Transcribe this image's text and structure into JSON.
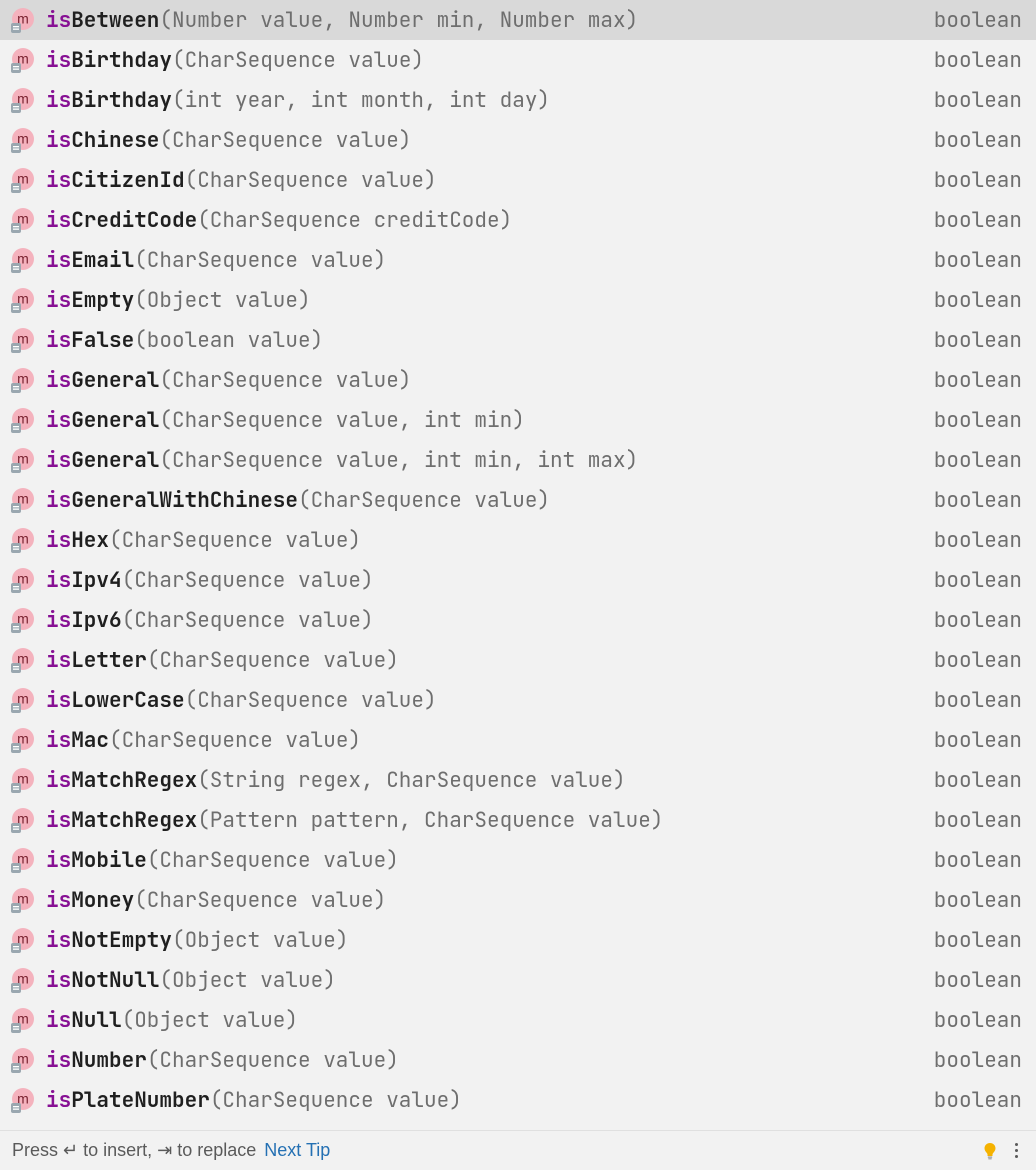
{
  "suggestions": [
    {
      "prefix": "is",
      "bold": "Between",
      "params": "(Number value, Number min, Number max)",
      "ret": "boolean",
      "selected": true
    },
    {
      "prefix": "is",
      "bold": "Birthday",
      "params": "(CharSequence value)",
      "ret": "boolean"
    },
    {
      "prefix": "is",
      "bold": "Birthday",
      "params": "(int year, int month, int day)",
      "ret": "boolean"
    },
    {
      "prefix": "is",
      "bold": "Chinese",
      "params": "(CharSequence value)",
      "ret": "boolean"
    },
    {
      "prefix": "is",
      "bold": "CitizenId",
      "params": "(CharSequence value)",
      "ret": "boolean"
    },
    {
      "prefix": "is",
      "bold": "CreditCode",
      "params": "(CharSequence creditCode)",
      "ret": "boolean"
    },
    {
      "prefix": "is",
      "bold": "Email",
      "params": "(CharSequence value)",
      "ret": "boolean"
    },
    {
      "prefix": "is",
      "bold": "Empty",
      "params": "(Object value)",
      "ret": "boolean"
    },
    {
      "prefix": "is",
      "bold": "False",
      "params": "(boolean value)",
      "ret": "boolean"
    },
    {
      "prefix": "is",
      "bold": "General",
      "params": "(CharSequence value)",
      "ret": "boolean"
    },
    {
      "prefix": "is",
      "bold": "General",
      "params": "(CharSequence value, int min)",
      "ret": "boolean"
    },
    {
      "prefix": "is",
      "bold": "General",
      "params": "(CharSequence value, int min, int max)",
      "ret": "boolean"
    },
    {
      "prefix": "is",
      "bold": "GeneralWithChinese",
      "params": "(CharSequence value)",
      "ret": "boolean"
    },
    {
      "prefix": "is",
      "bold": "Hex",
      "params": "(CharSequence value)",
      "ret": "boolean"
    },
    {
      "prefix": "is",
      "bold": "Ipv4",
      "params": "(CharSequence value)",
      "ret": "boolean"
    },
    {
      "prefix": "is",
      "bold": "Ipv6",
      "params": "(CharSequence value)",
      "ret": "boolean"
    },
    {
      "prefix": "is",
      "bold": "Letter",
      "params": "(CharSequence value)",
      "ret": "boolean"
    },
    {
      "prefix": "is",
      "bold": "LowerCase",
      "params": "(CharSequence value)",
      "ret": "boolean"
    },
    {
      "prefix": "is",
      "bold": "Mac",
      "params": "(CharSequence value)",
      "ret": "boolean"
    },
    {
      "prefix": "is",
      "bold": "MatchRegex",
      "params": "(String regex, CharSequence value)",
      "ret": "boolean"
    },
    {
      "prefix": "is",
      "bold": "MatchRegex",
      "params": "(Pattern pattern, CharSequence value)",
      "ret": "boolean"
    },
    {
      "prefix": "is",
      "bold": "Mobile",
      "params": "(CharSequence value)",
      "ret": "boolean"
    },
    {
      "prefix": "is",
      "bold": "Money",
      "params": "(CharSequence value)",
      "ret": "boolean"
    },
    {
      "prefix": "is",
      "bold": "NotEmpty",
      "params": "(Object value)",
      "ret": "boolean"
    },
    {
      "prefix": "is",
      "bold": "NotNull",
      "params": "(Object value)",
      "ret": "boolean"
    },
    {
      "prefix": "is",
      "bold": "Null",
      "params": "(Object value)",
      "ret": "boolean"
    },
    {
      "prefix": "is",
      "bold": "Number",
      "params": "(CharSequence value)",
      "ret": "boolean"
    },
    {
      "prefix": "is",
      "bold": "PlateNumber",
      "params": "(CharSequence value)",
      "ret": "boolean"
    }
  ],
  "footer": {
    "hint_prefix": "Press ",
    "hint_insert": " to insert, ",
    "hint_replace": " to replace",
    "next_tip": "Next Tip"
  }
}
